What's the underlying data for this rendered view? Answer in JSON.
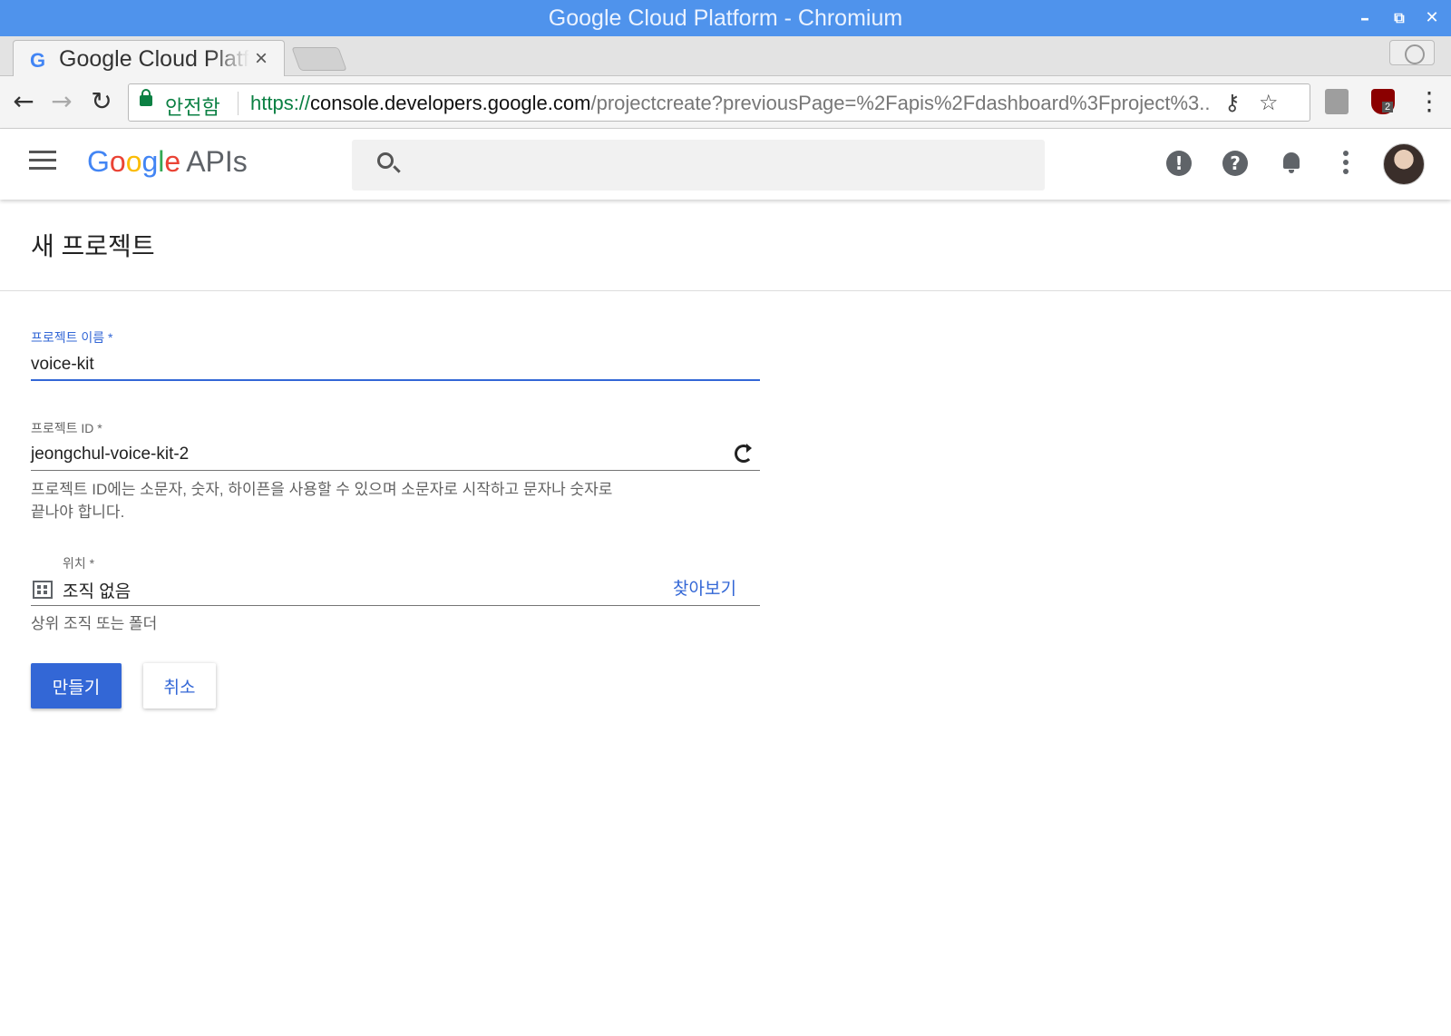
{
  "window": {
    "title": "Google Cloud Platform - Chromium",
    "controls": {
      "minimize": "–",
      "restore": "⧉",
      "close": "✕"
    }
  },
  "tab": {
    "favicon": "G",
    "title": "Google Cloud Platform",
    "close": "×"
  },
  "toolbar": {
    "back": "←",
    "forward": "→",
    "reload": "↻",
    "secure_label": "안전함",
    "url_scheme": "https://",
    "url_host": "console.developers.google.com",
    "url_path": "/projectcreate?previousPage=%2Fapis%2Fdashboard%3Fproject%3...",
    "key_icon": "⚷",
    "star": "☆",
    "ext_badge": "2",
    "menu": "⋮"
  },
  "header": {
    "logo_letters": [
      "G",
      "o",
      "o",
      "g",
      "l",
      "e"
    ],
    "logo_suffix": "APIs",
    "search_placeholder": "",
    "feedback_icon": "!",
    "help_icon": "?"
  },
  "page": {
    "title": "새 프로젝트"
  },
  "form": {
    "project_name": {
      "label": "프로젝트 이름 *",
      "value": "voice-kit"
    },
    "project_id": {
      "label": "프로젝트 ID *",
      "value": "jeongchul-voice-kit-2",
      "helper_line1": "프로젝트 ID에는 소문자, 숫자, 하이픈을 사용할 수 있으며 소문자로 시작하고 문자나 숫자로",
      "helper_line2": "끝나야 합니다."
    },
    "location": {
      "label": "위치 *",
      "value": "조직 없음",
      "browse": "찾아보기",
      "helper": "상위 조직 또는 폴더"
    },
    "create_button": "만들기",
    "cancel_button": "취소"
  },
  "colors": {
    "titlebar": "#4f93ec",
    "accent": "#3367d6",
    "secure": "#0b8043"
  }
}
